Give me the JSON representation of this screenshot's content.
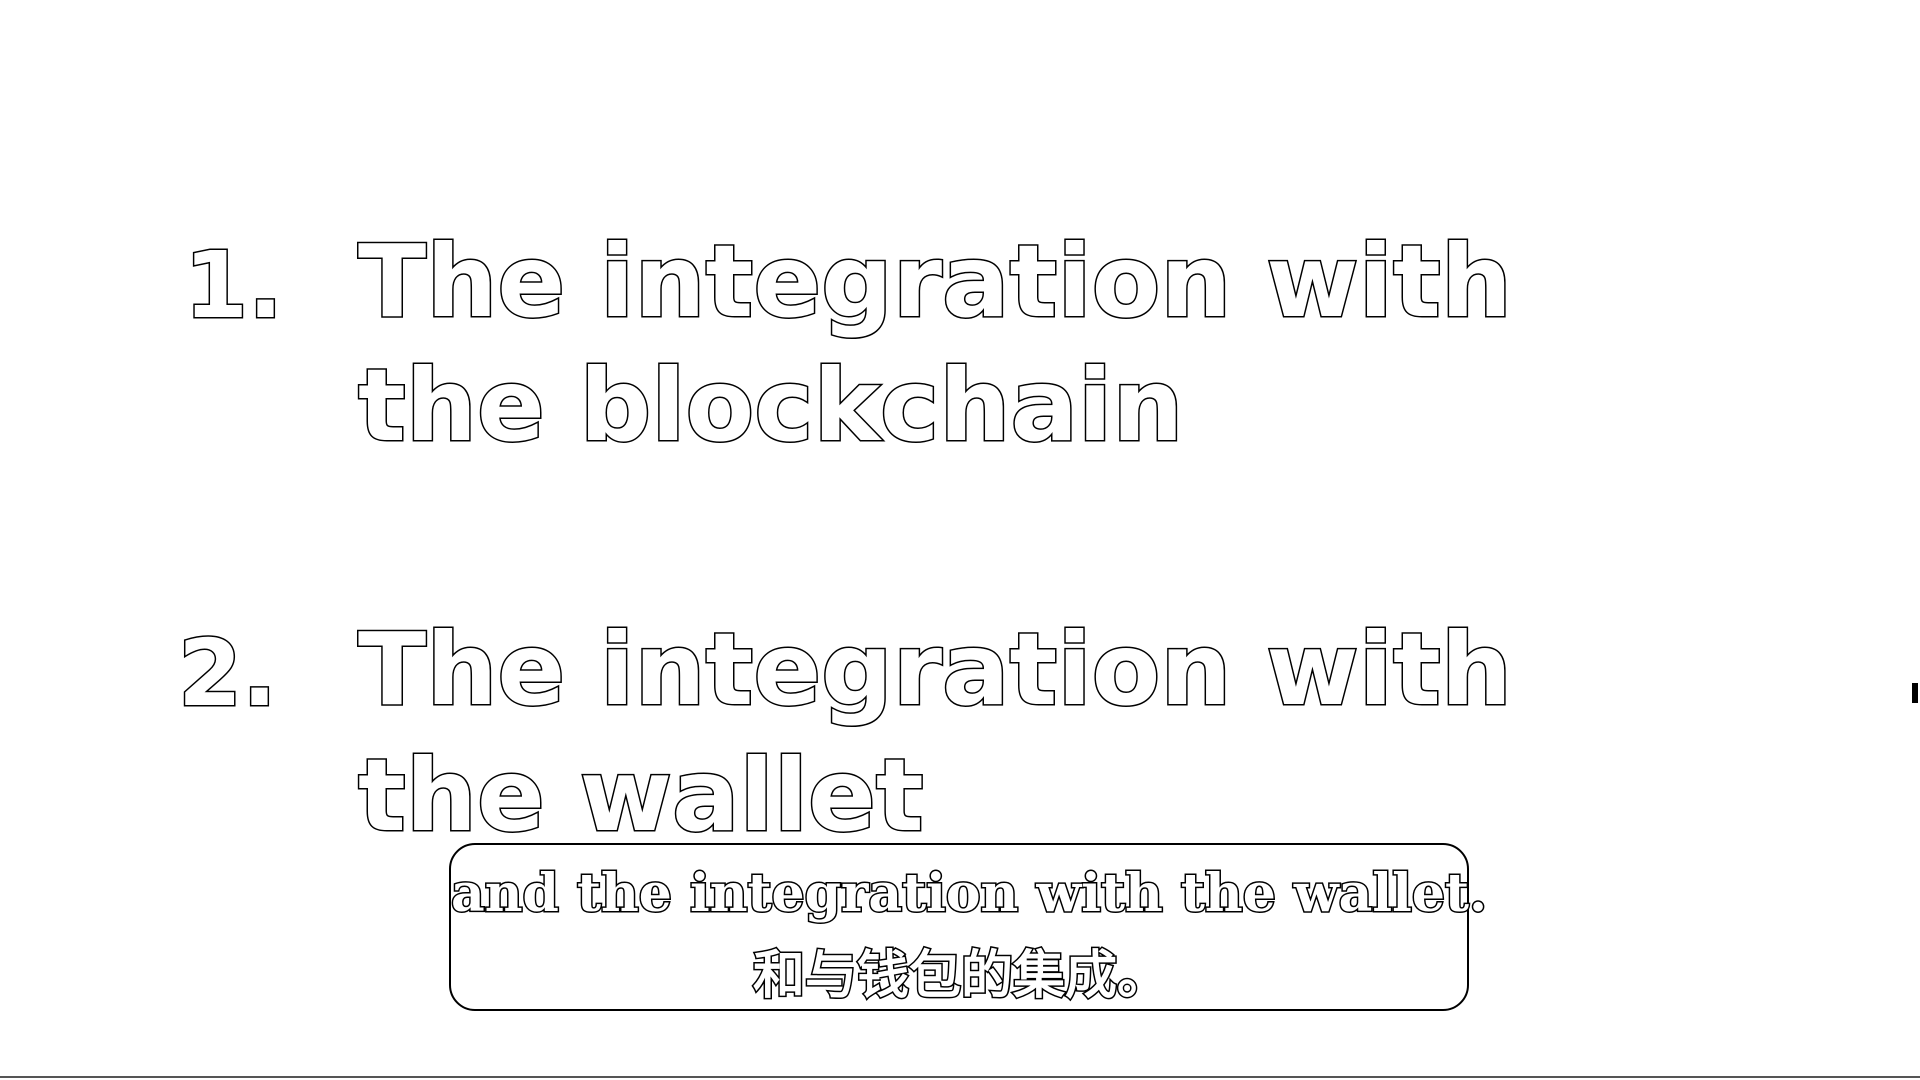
{
  "slide": {
    "items": [
      {
        "number": "1.",
        "lines": [
          "The integration with",
          "the blockchain"
        ]
      },
      {
        "number": "2.",
        "lines": [
          "The integration with",
          "the wallet"
        ]
      }
    ]
  },
  "subtitle": {
    "english": "and the integration with the wallet.",
    "chinese": "和与钱包的集成。"
  },
  "colors": {
    "background": "#ffffff",
    "text_fill": "#ffffff",
    "text_outline": "#000000"
  }
}
